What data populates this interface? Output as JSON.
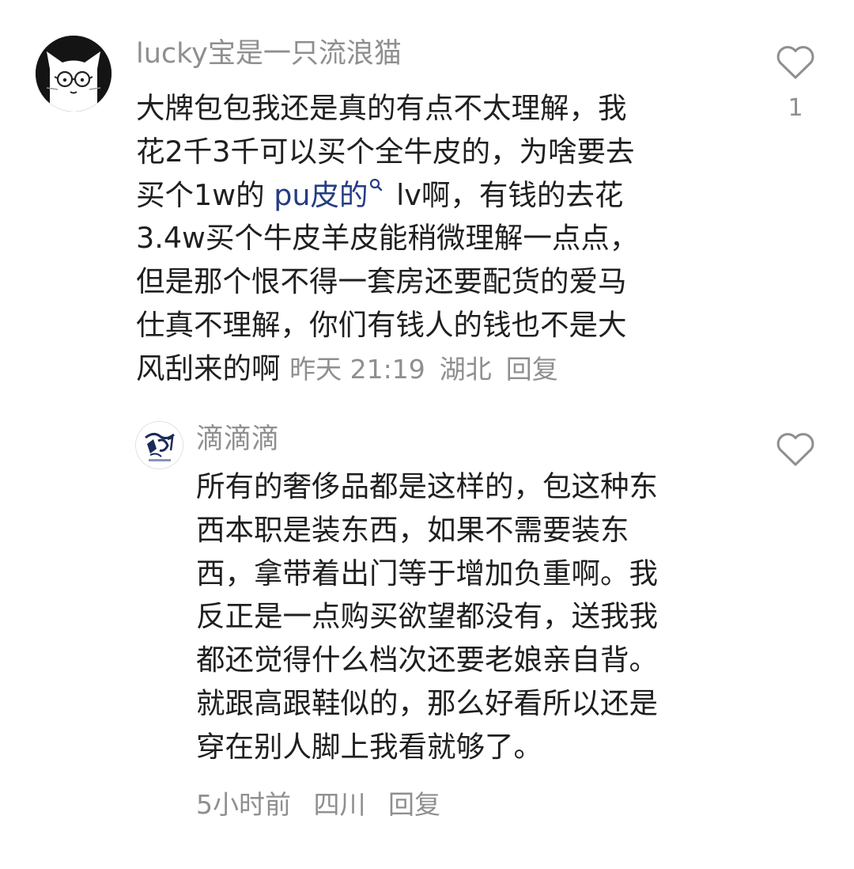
{
  "comments": [
    {
      "username": "lucky宝是一只流浪猫",
      "avatar_icon": "white-cat-with-glasses-avatar",
      "text_lines": [
        "大牌包包我还是真的有点不太理解，我",
        "花2千3千可以买个全牛皮的，为啥要去"
      ],
      "line3_before_link": "买个1w的 ",
      "link_text": "pu皮的",
      "line3_after_link": " lv啊，有钱的去花",
      "text_lines_after": [
        "3.4w买个牛皮羊皮能稍微理解一点点，",
        "但是那个恨不得一套房还要配货的爱马",
        "仕真不理解，你们有钱人的钱也不是大"
      ],
      "last_line": "风刮来的啊",
      "time": "昨天 21:19",
      "location": "湖北",
      "reply_label": "回复",
      "like_count": "1"
    },
    {
      "username": "滴滴滴",
      "avatar_icon": "ink-calligraphy-logo-avatar",
      "text_lines": [
        "所有的奢侈品都是这样的，包这种东",
        "西本职是装东西，如果不需要装东",
        "西，拿带着出门等于增加负重啊。我",
        "反正是一点购买欲望都没有，送我我",
        "都还觉得什么档次还要老娘亲自背。",
        "就跟高跟鞋似的，那么好看所以还是",
        "穿在别人脚上我看就够了。"
      ],
      "time": "5小时前",
      "location": "四川",
      "reply_label": "回复",
      "like_count": ""
    }
  ],
  "colors": {
    "text": "#1f1f1f",
    "secondary": "#8f8f8f",
    "link": "#253d82"
  }
}
